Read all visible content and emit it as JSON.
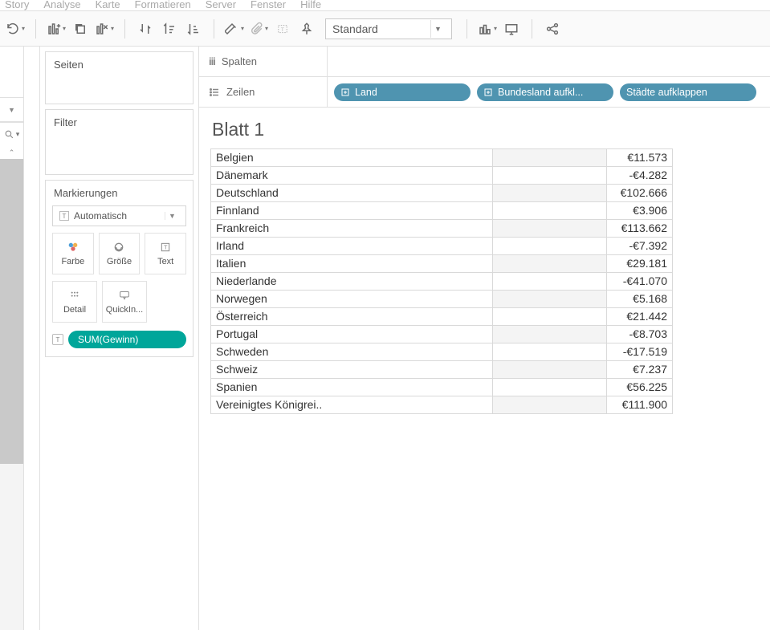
{
  "menubar": [
    "Story",
    "Analyse",
    "Karte",
    "Formatieren",
    "Server",
    "Fenster",
    "Hilfe"
  ],
  "toolbar": {
    "fit_label": "Standard"
  },
  "sidepanel": {
    "pages_title": "Seiten",
    "filter_title": "Filter",
    "marks_title": "Markierungen",
    "mark_type": "Automatisch",
    "cells": {
      "color": "Farbe",
      "size": "Größe",
      "text": "Text",
      "detail": "Detail",
      "tooltip": "QuickIn..."
    },
    "pill_measure": "SUM(Gewinn)"
  },
  "shelves": {
    "columns_label": "Spalten",
    "rows_label": "Zeilen",
    "row_pills": [
      {
        "label": "Land",
        "expand_icon": true
      },
      {
        "label": "Bundesland aufkl...",
        "expand_icon": true
      },
      {
        "label": "Städte aufklappen",
        "expand_icon": false
      }
    ]
  },
  "viz": {
    "title": "Blatt 1",
    "rows": [
      {
        "country": "Belgien",
        "value": "€11.573"
      },
      {
        "country": "Dänemark",
        "value": "-€4.282"
      },
      {
        "country": "Deutschland",
        "value": "€102.666"
      },
      {
        "country": "Finnland",
        "value": "€3.906"
      },
      {
        "country": "Frankreich",
        "value": "€113.662"
      },
      {
        "country": "Irland",
        "value": "-€7.392"
      },
      {
        "country": "Italien",
        "value": "€29.181"
      },
      {
        "country": "Niederlande",
        "value": "-€41.070"
      },
      {
        "country": "Norwegen",
        "value": "€5.168"
      },
      {
        "country": "Österreich",
        "value": "€21.442"
      },
      {
        "country": "Portugal",
        "value": "-€8.703"
      },
      {
        "country": "Schweden",
        "value": "-€17.519"
      },
      {
        "country": "Schweiz",
        "value": "€7.237"
      },
      {
        "country": "Spanien",
        "value": "€56.225"
      },
      {
        "country": "Vereinigtes Königrei..",
        "value": "€111.900"
      }
    ]
  },
  "chart_data": {
    "type": "table",
    "title": "Blatt 1",
    "measure": "SUM(Gewinn)",
    "dimension": "Land",
    "rows": [
      {
        "Land": "Belgien",
        "Gewinn": 11573
      },
      {
        "Land": "Dänemark",
        "Gewinn": -4282
      },
      {
        "Land": "Deutschland",
        "Gewinn": 102666
      },
      {
        "Land": "Finnland",
        "Gewinn": 3906
      },
      {
        "Land": "Frankreich",
        "Gewinn": 113662
      },
      {
        "Land": "Irland",
        "Gewinn": -7392
      },
      {
        "Land": "Italien",
        "Gewinn": 29181
      },
      {
        "Land": "Niederlande",
        "Gewinn": -41070
      },
      {
        "Land": "Norwegen",
        "Gewinn": 5168
      },
      {
        "Land": "Österreich",
        "Gewinn": 21442
      },
      {
        "Land": "Portugal",
        "Gewinn": -8703
      },
      {
        "Land": "Schweden",
        "Gewinn": -17519
      },
      {
        "Land": "Schweiz",
        "Gewinn": 7237
      },
      {
        "Land": "Spanien",
        "Gewinn": 56225
      },
      {
        "Land": "Vereinigtes Königreich",
        "Gewinn": 111900
      }
    ]
  }
}
